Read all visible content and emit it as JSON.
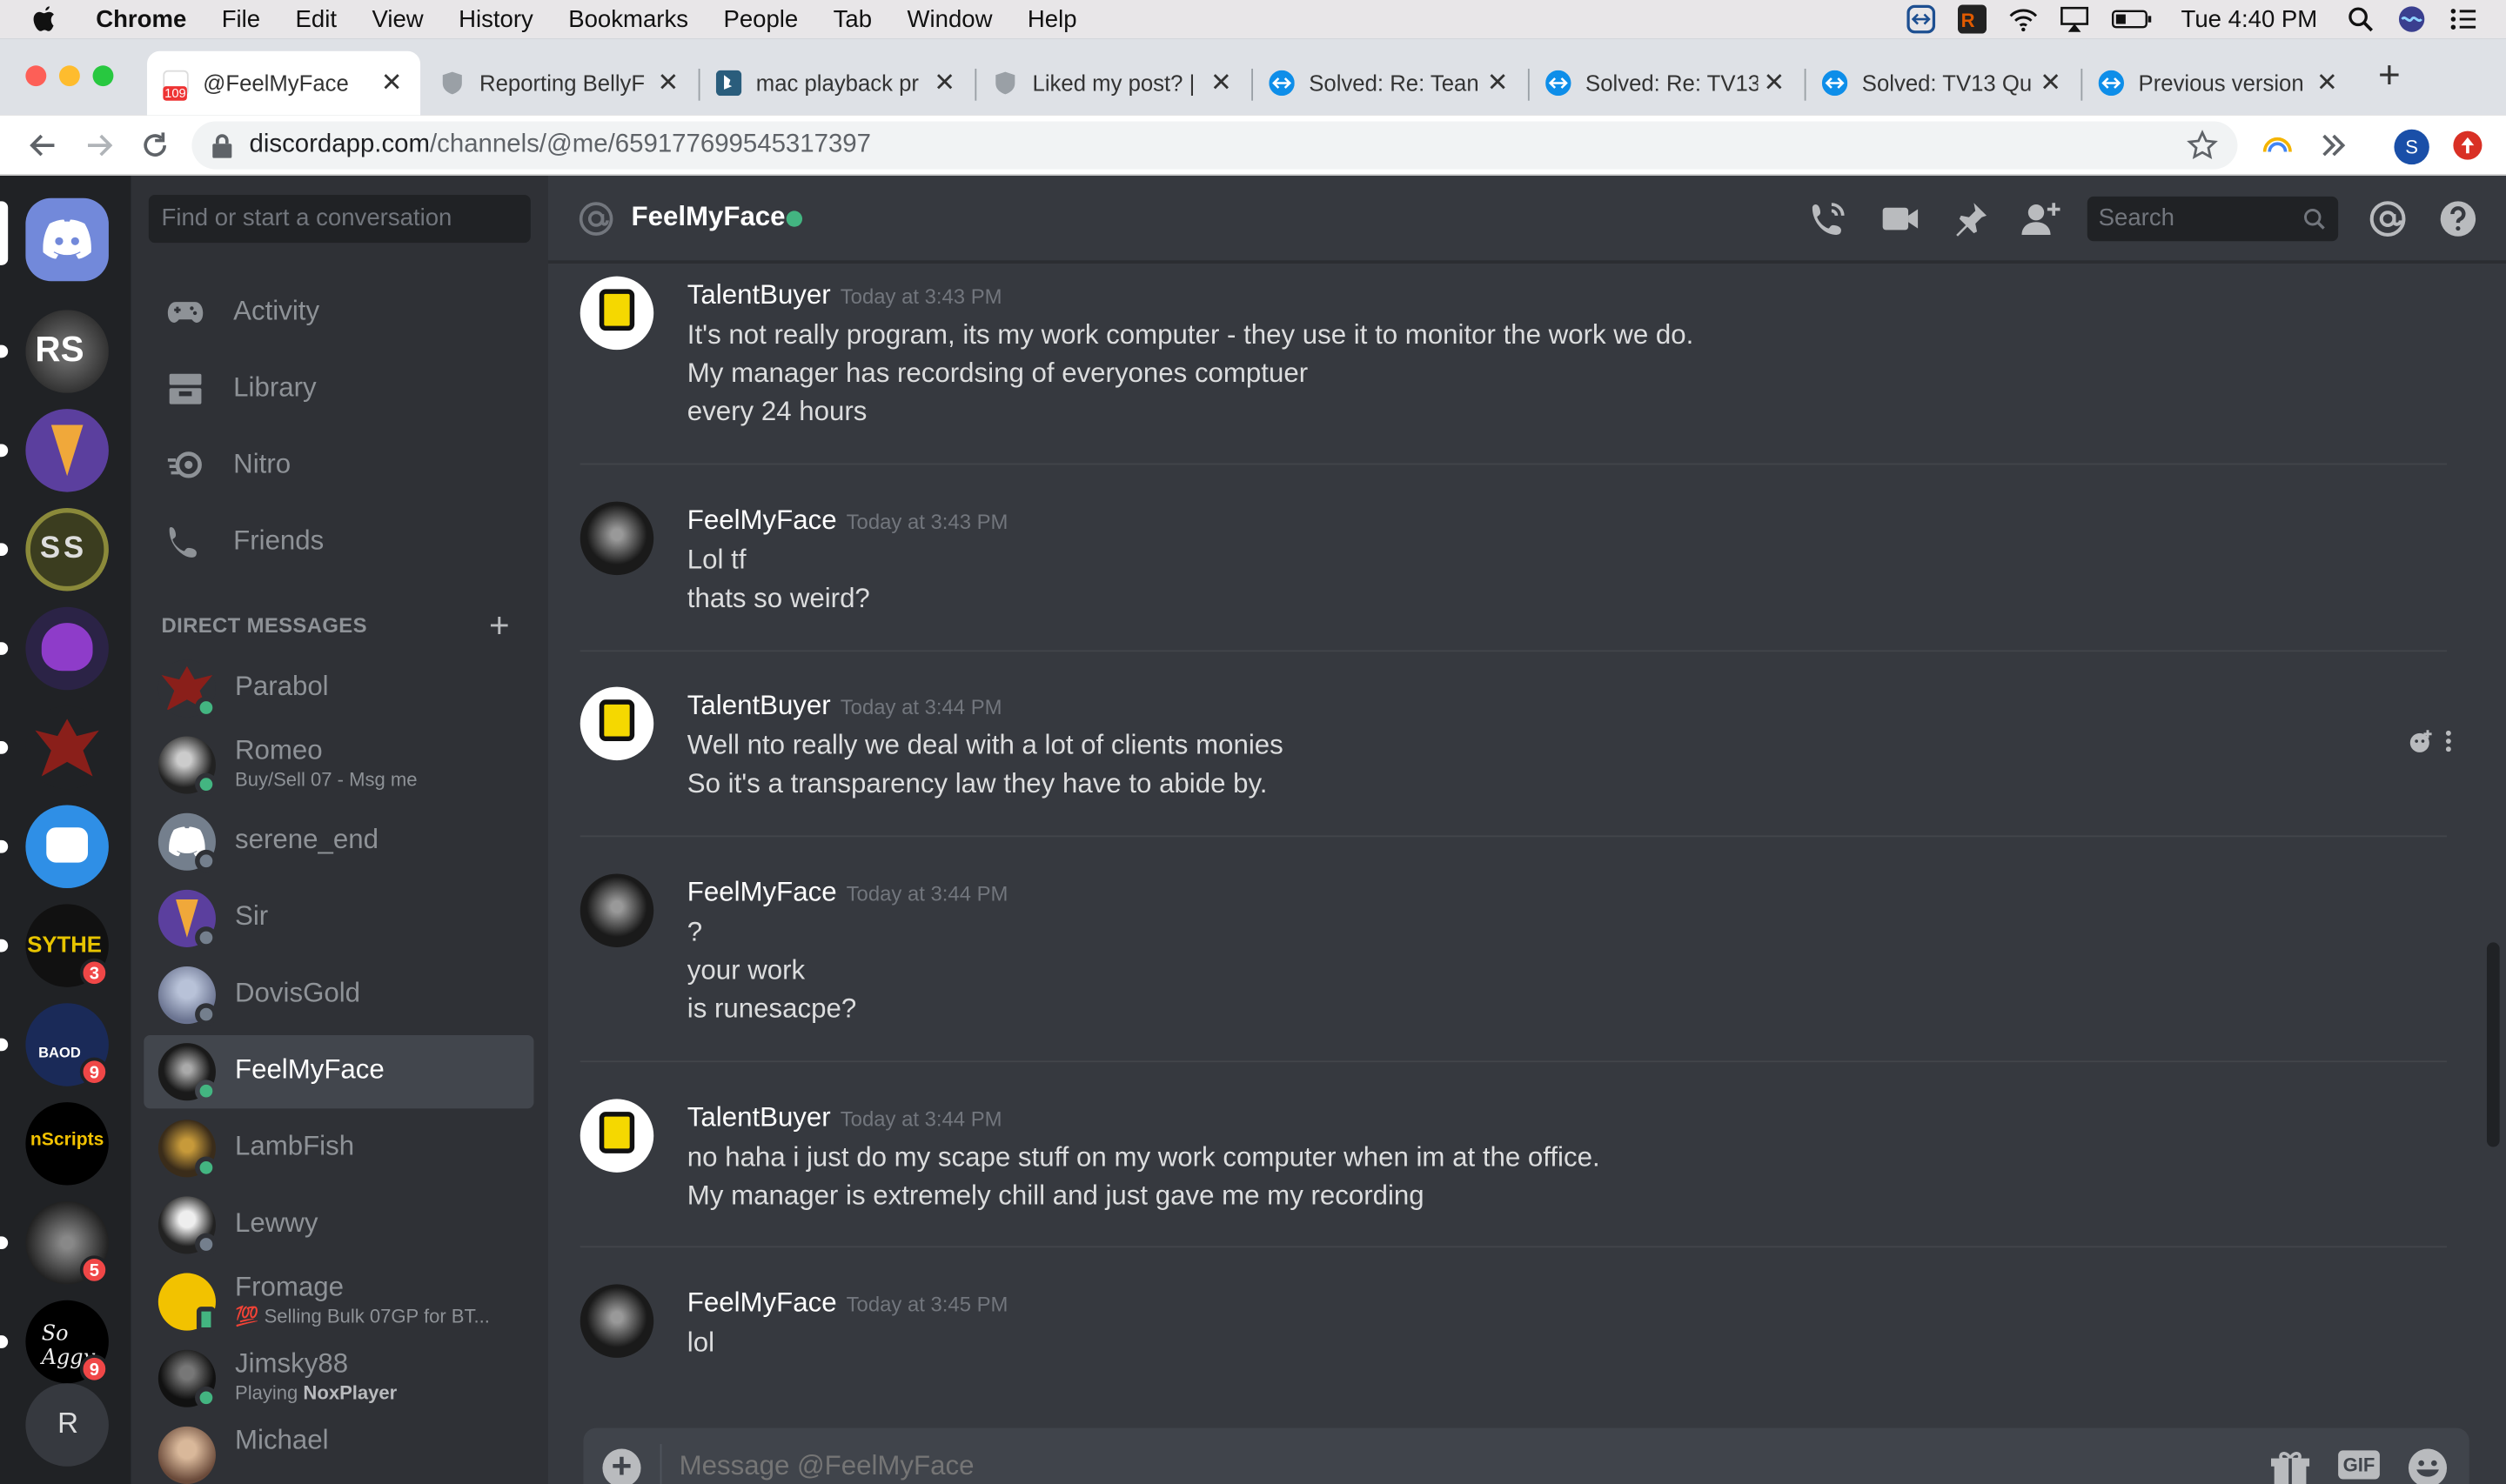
{
  "menubar": {
    "app": "Chrome",
    "items": [
      "File",
      "Edit",
      "View",
      "History",
      "Bookmarks",
      "People",
      "Tab",
      "Window",
      "Help"
    ],
    "clock": "Tue 4:40 PM"
  },
  "tabs": [
    {
      "label": "@FeelMyFace",
      "active": true
    },
    {
      "label": "Reporting BellyF",
      "active": false
    },
    {
      "label": "mac playback pr",
      "active": false
    },
    {
      "label": "Liked my post? |",
      "active": false
    },
    {
      "label": "Solved: Re: Tean",
      "active": false
    },
    {
      "label": "Solved: Re: TV13",
      "active": false
    },
    {
      "label": "Solved: TV13 Qu",
      "active": false
    },
    {
      "label": "Previous version",
      "active": false
    }
  ],
  "address": {
    "host": "discordapp.com",
    "path": "/channels/@me/659177699545317397"
  },
  "profile_initial": "S",
  "favicon_badge": "109",
  "guilds": [
    {
      "label": "RS"
    },
    {
      "label": ""
    },
    {
      "label": "SS"
    },
    {
      "label": ""
    },
    {
      "label": ""
    },
    {
      "label": ""
    },
    {
      "label": "SYTHE",
      "badge": "3"
    },
    {
      "label": "BAOD",
      "badge": "9"
    },
    {
      "label": "nScripts"
    },
    {
      "label": "",
      "badge": "5"
    },
    {
      "label": "So Aggy",
      "badge": "9"
    },
    {
      "label": "R"
    }
  ],
  "sidebar": {
    "search_placeholder": "Find or start a conversation",
    "nav": [
      "Activity",
      "Library",
      "Nitro",
      "Friends"
    ],
    "dm_header": "DIRECT MESSAGES",
    "dms": [
      {
        "name": "Parabol",
        "status": "online"
      },
      {
        "name": "Romeo",
        "sub": "Buy/Sell 07 - Msg me",
        "status": "online"
      },
      {
        "name": "serene_end",
        "status": "offline"
      },
      {
        "name": "Sir",
        "status": "offline"
      },
      {
        "name": "DovisGold",
        "status": "offline"
      },
      {
        "name": "FeelMyFace",
        "status": "online",
        "active": true
      },
      {
        "name": "LambFish",
        "status": "online"
      },
      {
        "name": "Lewwy",
        "status": "offline"
      },
      {
        "name": "Fromage",
        "sub": "💯 Selling Bulk 07GP for BT...",
        "status": "mobile"
      },
      {
        "name": "Jimsky88",
        "sub_prefix": "Playing ",
        "sub_bold": "NoxPlayer",
        "status": "online"
      },
      {
        "name": "Michael",
        "status": "offline"
      }
    ]
  },
  "header": {
    "title": "FeelMyFace",
    "search_placeholder": "Search"
  },
  "messages": [
    {
      "author": "TalentBuyer",
      "time": "Today at 3:43 PM",
      "lines": [
        "It's not really program, its my work computer - they use it to monitor the work we do.",
        "My manager has recordsing of everyones comptuer",
        "every 24 hours"
      ]
    },
    {
      "author": "FeelMyFace",
      "time": "Today at 3:43 PM",
      "lines": [
        "Lol tf",
        "thats so weird?"
      ]
    },
    {
      "author": "TalentBuyer",
      "time": "Today at 3:44 PM",
      "lines": [
        "Well nto really we deal with a lot of clients monies",
        "So it's a transparency law they have to abide by."
      ]
    },
    {
      "author": "FeelMyFace",
      "time": "Today at 3:44 PM",
      "lines": [
        "?",
        "your work",
        "is runesacpe?"
      ]
    },
    {
      "author": "TalentBuyer",
      "time": "Today at 3:44 PM",
      "lines": [
        "no haha i just do my scape stuff on my work computer when im at the office.",
        "My manager is extremely chill and just gave me my recording"
      ]
    },
    {
      "author": "FeelMyFace",
      "time": "Today at 3:45 PM",
      "lines": [
        "lol"
      ]
    }
  ],
  "composer": {
    "placeholder": "Message @FeelMyFace",
    "gif_label": "GIF"
  },
  "colors": {
    "blurple": "#7289da",
    "online": "#43b581",
    "badge": "#f04747"
  }
}
